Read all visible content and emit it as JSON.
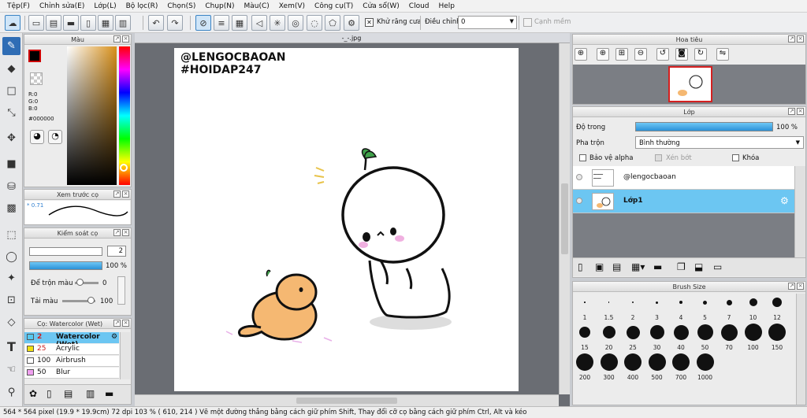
{
  "menu": [
    "Tệp(F)",
    "Chỉnh sửa(E)",
    "Lớp(L)",
    "Bộ lọc(R)",
    "Chọn(S)",
    "Chụp(N)",
    "Màu(C)",
    "Xem(V)",
    "Công cụ(T)",
    "Cửa sổ(W)",
    "Cloud",
    "Help"
  ],
  "toolbar": {
    "antialias_label": "Khử răng cưa",
    "adjust_label": "Điều chỉnh",
    "adjust_value": "0",
    "soft_edge_label": "Cạnh mềm"
  },
  "tab": {
    "title": "-_-.jpg"
  },
  "color_panel": {
    "title": "Màu",
    "r": "R:0",
    "g": "G:0",
    "b": "B:0",
    "hex": "#000000",
    "fg": "#000000"
  },
  "preview_panel": {
    "title": "Xem trước cọ",
    "size": "0.71"
  },
  "brush_control": {
    "title": "Kiểm soát cọ",
    "size": "2",
    "opacity": "100 %",
    "blend_label": "Để trộn màu",
    "blend_value": "0",
    "reload_label": "Tải màu",
    "reload_value": "100"
  },
  "brush_list": {
    "title": "Cọ: Watercolor (Wet)",
    "items": [
      {
        "size": "2",
        "name": "Watercolor (Wet)",
        "color": "#55c8f0",
        "selected": true
      },
      {
        "size": "25",
        "name": "Acrylic",
        "color": "#f0e010",
        "selected": false
      },
      {
        "size": "100",
        "name": "Airbrush",
        "color": "#ffffff",
        "selected": false
      },
      {
        "size": "50",
        "name": "Blur",
        "color": "#f0a0f0",
        "selected": false
      }
    ]
  },
  "navigator": {
    "title": "Hoa tiêu"
  },
  "layer_panel": {
    "title": "Lớp",
    "opacity_label": "Độ trong",
    "opacity_value": "100 %",
    "opacity_fill": 1.0,
    "blend_label": "Pha trộn",
    "blend_value": "Bình thường",
    "protect_alpha": "Bảo vệ alpha",
    "clip": "Xén bớt",
    "lock": "Khóa",
    "layers": [
      {
        "name": "@lengocbaoan",
        "selected": false
      },
      {
        "name": "Lớp1",
        "selected": true
      }
    ]
  },
  "brush_size": {
    "title": "Brush Size",
    "sizes": [
      "1",
      "1.5",
      "2",
      "3",
      "4",
      "5",
      "7",
      "10",
      "12",
      "15",
      "20",
      "25",
      "30",
      "40",
      "50",
      "70",
      "100",
      "150",
      "200",
      "300",
      "400",
      "500",
      "700",
      "1000"
    ]
  },
  "canvas_text": {
    "line1": "@LENGOCBAOAN",
    "line2": "#HOIDAP247"
  },
  "status": {
    "text": "564 * 564 pixel   (19.9 * 19.9cm)   72 dpi   103 %   ( 610, 214 )   Vẽ một đường thẳng bằng cách giữ phím Shift, Thay đổi cỡ cọ bằng cách giữ phím Ctrl, Alt và kéo"
  },
  "colors": {
    "accent": "#2f6db5",
    "selected_row": "#6cc6f2",
    "nav_border": "#d42020"
  }
}
